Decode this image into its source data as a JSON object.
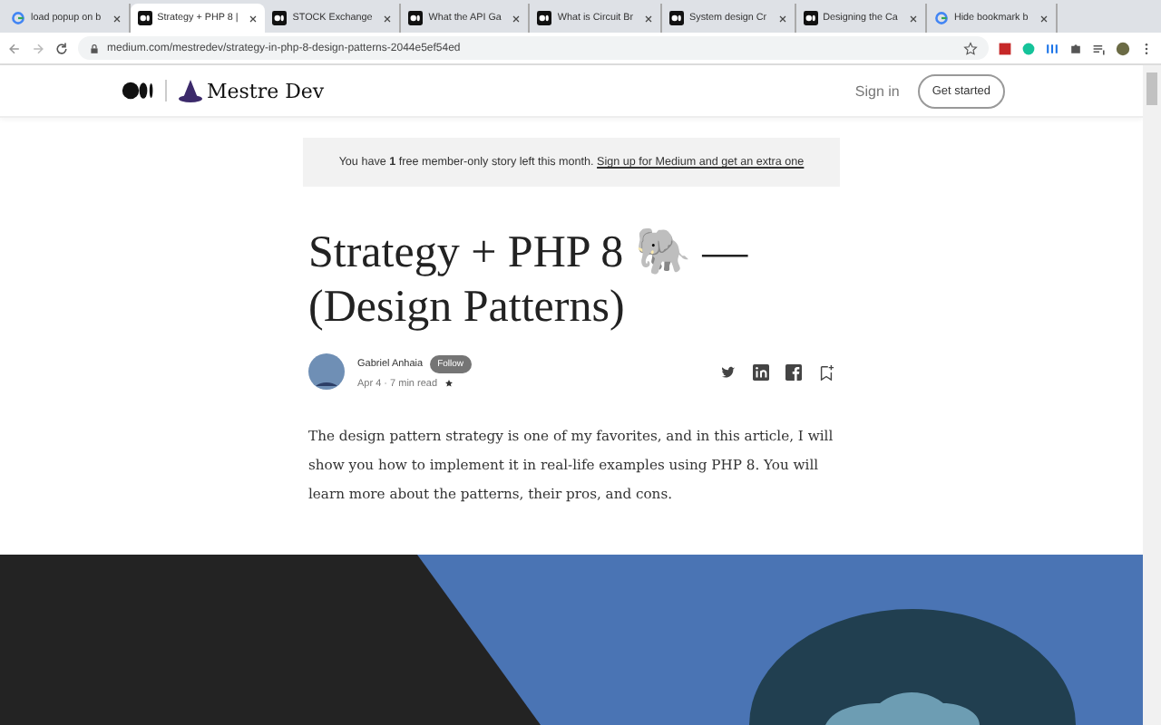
{
  "tabs": [
    {
      "title": "load popup on b",
      "kind": "google",
      "selected": false
    },
    {
      "title": "Strategy + PHP 8 |",
      "kind": "medium",
      "selected": true
    },
    {
      "title": "STOCK Exchange",
      "kind": "medium",
      "selected": false
    },
    {
      "title": "What the API Ga",
      "kind": "medium",
      "selected": false
    },
    {
      "title": "What is Circuit Br",
      "kind": "medium",
      "selected": false
    },
    {
      "title": "System design Cr",
      "kind": "medium",
      "selected": false
    },
    {
      "title": "Designing the Ca",
      "kind": "medium",
      "selected": false
    },
    {
      "title": "Hide bookmark b",
      "kind": "google",
      "selected": false
    }
  ],
  "address_bar": {
    "url": "medium.com/mestredev/strategy-in-php-8-design-patterns-2044e5ef54ed"
  },
  "site_header": {
    "publication": "Mestre Dev",
    "sign_in": "Sign in",
    "get_started": "Get started"
  },
  "banner": {
    "text": "You have **1** free member-only story left this month.",
    "link": "Sign up for Medium and get an extra one"
  },
  "article": {
    "title": "Strategy + PHP 8 🐘 — (Design Patterns)",
    "author": "Gabriel Anhaia",
    "follow": "Follow",
    "meta": "Apr 4 · 7 min read",
    "intro": "The design pattern strategy is one of my favorites, and in this article, I will show you how to implement it in real-life examples using PHP 8. You will learn more about the patterns, their pros, and cons."
  }
}
